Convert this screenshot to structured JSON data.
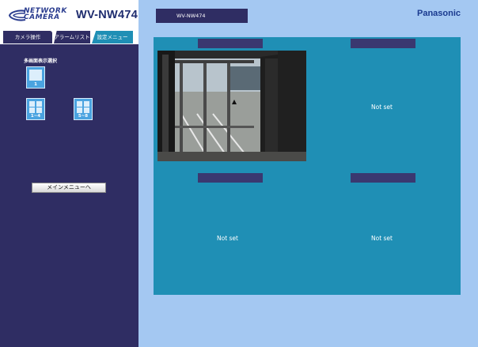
{
  "header": {
    "logo_line1": "NETWORK",
    "logo_line2": "CAMERA",
    "model": "WV-NW474",
    "camera_name": "WV-NW474",
    "brand": "Panasonic"
  },
  "tabs": [
    {
      "label": "カメラ操作"
    },
    {
      "label": "アラームリスト"
    },
    {
      "label": "設定メニュー"
    }
  ],
  "sidebar": {
    "section_label": "多画面表示選択",
    "layouts": [
      {
        "label": "1"
      },
      {
        "label": "1~4"
      },
      {
        "label": "5~8"
      }
    ],
    "main_menu_label": "メインメニューへ"
  },
  "grid": {
    "cells": [
      {
        "title": "",
        "status": ""
      },
      {
        "title": "",
        "status": "Not set"
      },
      {
        "title": "",
        "status": "Not set"
      },
      {
        "title": "",
        "status": "Not set"
      }
    ]
  },
  "colors": {
    "background": "#a4c8f2",
    "panel": "#2f2d63",
    "grid": "#1f8fb5",
    "brand": "#1a3a8f"
  }
}
